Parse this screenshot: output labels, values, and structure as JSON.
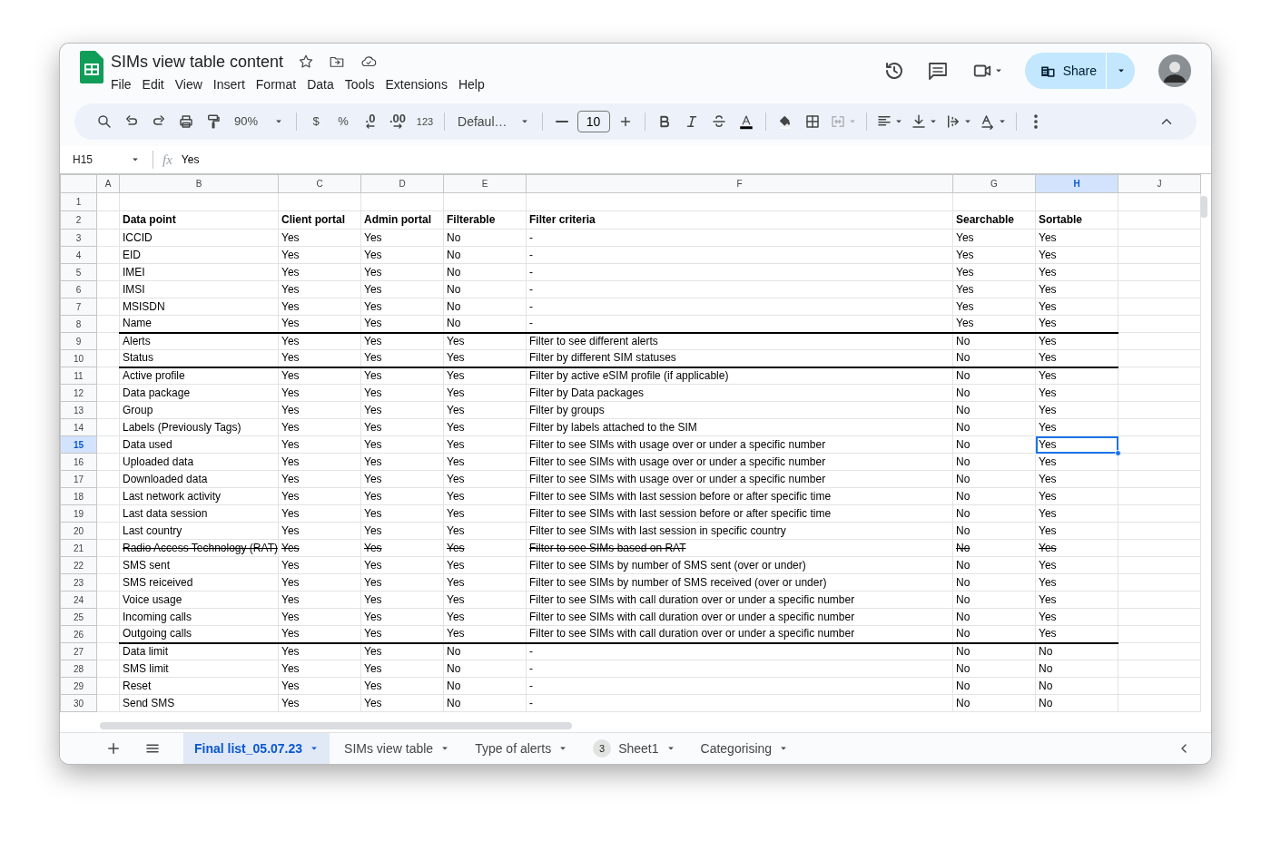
{
  "app": {
    "title": "SIMs view table content",
    "menu": [
      "File",
      "Edit",
      "View",
      "Insert",
      "Format",
      "Data",
      "Tools",
      "Extensions",
      "Help"
    ],
    "share": "Share"
  },
  "toolbar": {
    "zoom": "90%",
    "currency": "$",
    "percent": "%",
    "decrease_decimals": ".0",
    "increase_decimals": ".00",
    "more_formats": "123",
    "font": "Defaul…",
    "font_size": "10"
  },
  "formula_bar": {
    "name_box": "H15",
    "function_label": "fx",
    "value": "Yes"
  },
  "columns": [
    {
      "label": "A",
      "selected": false
    },
    {
      "label": "B",
      "selected": false
    },
    {
      "label": "C",
      "selected": false
    },
    {
      "label": "D",
      "selected": false
    },
    {
      "label": "E",
      "selected": false
    },
    {
      "label": "F",
      "selected": false
    },
    {
      "label": "G",
      "selected": false
    },
    {
      "label": "H",
      "selected": true
    },
    {
      "label": "J",
      "selected": false
    }
  ],
  "rows": [
    {
      "number": "1",
      "kind": "blank",
      "selected": false
    },
    {
      "number": "2",
      "kind": "header",
      "selected": false,
      "struck": false,
      "cells": [
        "Data point",
        "Client portal",
        "Admin portal",
        "Filterable",
        "Filter criteria",
        "Searchable",
        "Sortable"
      ]
    },
    {
      "number": "3",
      "kind": "data",
      "selected": false,
      "struck": false,
      "section_end": false,
      "cells": [
        "ICCID",
        "Yes",
        "Yes",
        "No",
        "-",
        "Yes",
        "Yes"
      ]
    },
    {
      "number": "4",
      "kind": "data",
      "selected": false,
      "struck": false,
      "section_end": false,
      "cells": [
        "EID",
        "Yes",
        "Yes",
        "No",
        "-",
        "Yes",
        "Yes"
      ]
    },
    {
      "number": "5",
      "kind": "data",
      "selected": false,
      "struck": false,
      "section_end": false,
      "cells": [
        "IMEI",
        "Yes",
        "Yes",
        "No",
        "-",
        "Yes",
        "Yes"
      ]
    },
    {
      "number": "6",
      "kind": "data",
      "selected": false,
      "struck": false,
      "section_end": false,
      "cells": [
        "IMSI",
        "Yes",
        "Yes",
        "No",
        "-",
        "Yes",
        "Yes"
      ]
    },
    {
      "number": "7",
      "kind": "data",
      "selected": false,
      "struck": false,
      "section_end": false,
      "cells": [
        "MSISDN",
        "Yes",
        "Yes",
        "No",
        "-",
        "Yes",
        "Yes"
      ]
    },
    {
      "number": "8",
      "kind": "data",
      "selected": false,
      "struck": false,
      "section_end": true,
      "cells": [
        "Name",
        "Yes",
        "Yes",
        "No",
        "-",
        "Yes",
        "Yes"
      ]
    },
    {
      "number": "9",
      "kind": "data",
      "selected": false,
      "struck": false,
      "section_end": false,
      "cells": [
        "Alerts",
        "Yes",
        "Yes",
        "Yes",
        "Filter to see different alerts",
        "No",
        "Yes"
      ]
    },
    {
      "number": "10",
      "kind": "data",
      "selected": false,
      "struck": false,
      "section_end": true,
      "cells": [
        "Status",
        "Yes",
        "Yes",
        "Yes",
        "Filter by different SIM statuses",
        "No",
        "Yes"
      ]
    },
    {
      "number": "11",
      "kind": "data",
      "selected": false,
      "struck": false,
      "section_end": false,
      "cells": [
        "Active profile",
        "Yes",
        "Yes",
        "Yes",
        "Filter by active eSIM profile (if applicable)",
        "No",
        "Yes"
      ]
    },
    {
      "number": "12",
      "kind": "data",
      "selected": false,
      "struck": false,
      "section_end": false,
      "cells": [
        "Data package",
        "Yes",
        "Yes",
        "Yes",
        "Filter by Data packages",
        "No",
        "Yes"
      ]
    },
    {
      "number": "13",
      "kind": "data",
      "selected": false,
      "struck": false,
      "section_end": false,
      "cells": [
        "Group",
        "Yes",
        "Yes",
        "Yes",
        "Filter by groups",
        "No",
        "Yes"
      ]
    },
    {
      "number": "14",
      "kind": "data",
      "selected": false,
      "struck": false,
      "section_end": false,
      "cells": [
        "Labels (Previously Tags)",
        "Yes",
        "Yes",
        "Yes",
        "Filter by labels attached to the SIM",
        "No",
        "Yes"
      ]
    },
    {
      "number": "15",
      "kind": "data",
      "selected": true,
      "struck": false,
      "section_end": false,
      "cells": [
        "Data used",
        "Yes",
        "Yes",
        "Yes",
        "Filter to see SIMs with usage over or under a specific number",
        "No",
        "Yes"
      ]
    },
    {
      "number": "16",
      "kind": "data",
      "selected": false,
      "struck": false,
      "section_end": false,
      "cells": [
        "Uploaded data",
        "Yes",
        "Yes",
        "Yes",
        "Filter to see SIMs with usage over or under a specific number",
        "No",
        "Yes"
      ]
    },
    {
      "number": "17",
      "kind": "data",
      "selected": false,
      "struck": false,
      "section_end": false,
      "cells": [
        "Downloaded data",
        "Yes",
        "Yes",
        "Yes",
        "Filter to see SIMs with usage over or under a specific number",
        "No",
        "Yes"
      ]
    },
    {
      "number": "18",
      "kind": "data",
      "selected": false,
      "struck": false,
      "section_end": false,
      "cells": [
        "Last network activity",
        "Yes",
        "Yes",
        "Yes",
        "Filter to see SIMs with last session before or after specific time",
        "No",
        "Yes"
      ]
    },
    {
      "number": "19",
      "kind": "data",
      "selected": false,
      "struck": false,
      "section_end": false,
      "cells": [
        "Last data session",
        "Yes",
        "Yes",
        "Yes",
        "Filter to see SIMs with last session before or after specific time",
        "No",
        "Yes"
      ]
    },
    {
      "number": "20",
      "kind": "data",
      "selected": false,
      "struck": false,
      "section_end": false,
      "cells": [
        "Last country",
        "Yes",
        "Yes",
        "Yes",
        "Filter to see SIMs with last session in specific country",
        "No",
        "Yes"
      ]
    },
    {
      "number": "21",
      "kind": "data",
      "selected": false,
      "struck": true,
      "section_end": false,
      "cells": [
        "Radio Access Technology (RAT)",
        "Yes",
        "Yes",
        "Yes",
        "Filter to see SIMs based on RAT",
        "No",
        "Yes"
      ]
    },
    {
      "number": "22",
      "kind": "data",
      "selected": false,
      "struck": false,
      "section_end": false,
      "cells": [
        "SMS sent",
        "Yes",
        "Yes",
        "Yes",
        "Filter to see SIMs by number of SMS sent (over or under)",
        "No",
        "Yes"
      ]
    },
    {
      "number": "23",
      "kind": "data",
      "selected": false,
      "struck": false,
      "section_end": false,
      "cells": [
        "SMS reiceived",
        "Yes",
        "Yes",
        "Yes",
        "Filter to see SIMs by number of SMS received (over or under)",
        "No",
        "Yes"
      ]
    },
    {
      "number": "24",
      "kind": "data",
      "selected": false,
      "struck": false,
      "section_end": false,
      "cells": [
        "Voice usage",
        "Yes",
        "Yes",
        "Yes",
        "Filter to see SIMs with call duration over or under a specific number",
        "No",
        "Yes"
      ]
    },
    {
      "number": "25",
      "kind": "data",
      "selected": false,
      "struck": false,
      "section_end": false,
      "cells": [
        "Incoming calls",
        "Yes",
        "Yes",
        "Yes",
        "Filter to see SIMs with call duration over or under a specific number",
        "No",
        "Yes"
      ]
    },
    {
      "number": "26",
      "kind": "data",
      "selected": false,
      "struck": false,
      "section_end": true,
      "cells": [
        "Outgoing calls",
        "Yes",
        "Yes",
        "Yes",
        "Filter to see SIMs with call duration over or under a specific number",
        "No",
        "Yes"
      ]
    },
    {
      "number": "27",
      "kind": "data",
      "selected": false,
      "struck": false,
      "section_end": false,
      "cells": [
        "Data limit",
        "Yes",
        "Yes",
        "No",
        "-",
        "No",
        "No"
      ]
    },
    {
      "number": "28",
      "kind": "data",
      "selected": false,
      "struck": false,
      "section_end": false,
      "cells": [
        "SMS limit",
        "Yes",
        "Yes",
        "No",
        "-",
        "No",
        "No"
      ]
    },
    {
      "number": "29",
      "kind": "data",
      "selected": false,
      "struck": false,
      "section_end": false,
      "cells": [
        "Reset",
        "Yes",
        "Yes",
        "No",
        "-",
        "No",
        "No"
      ]
    },
    {
      "number": "30",
      "kind": "data",
      "selected": false,
      "struck": false,
      "section_end": false,
      "cells": [
        "Send SMS",
        "Yes",
        "Yes",
        "No",
        "-",
        "No",
        "No"
      ]
    }
  ],
  "sheet_tabs": [
    {
      "label": "Final list_05.07.23",
      "selected": true
    },
    {
      "label": "SIMs view table",
      "selected": false
    },
    {
      "label": "Type of alerts",
      "selected": false
    },
    {
      "label": "Sheet1",
      "selected": false,
      "badge": "3"
    },
    {
      "label": "Categorising",
      "selected": false
    }
  ]
}
